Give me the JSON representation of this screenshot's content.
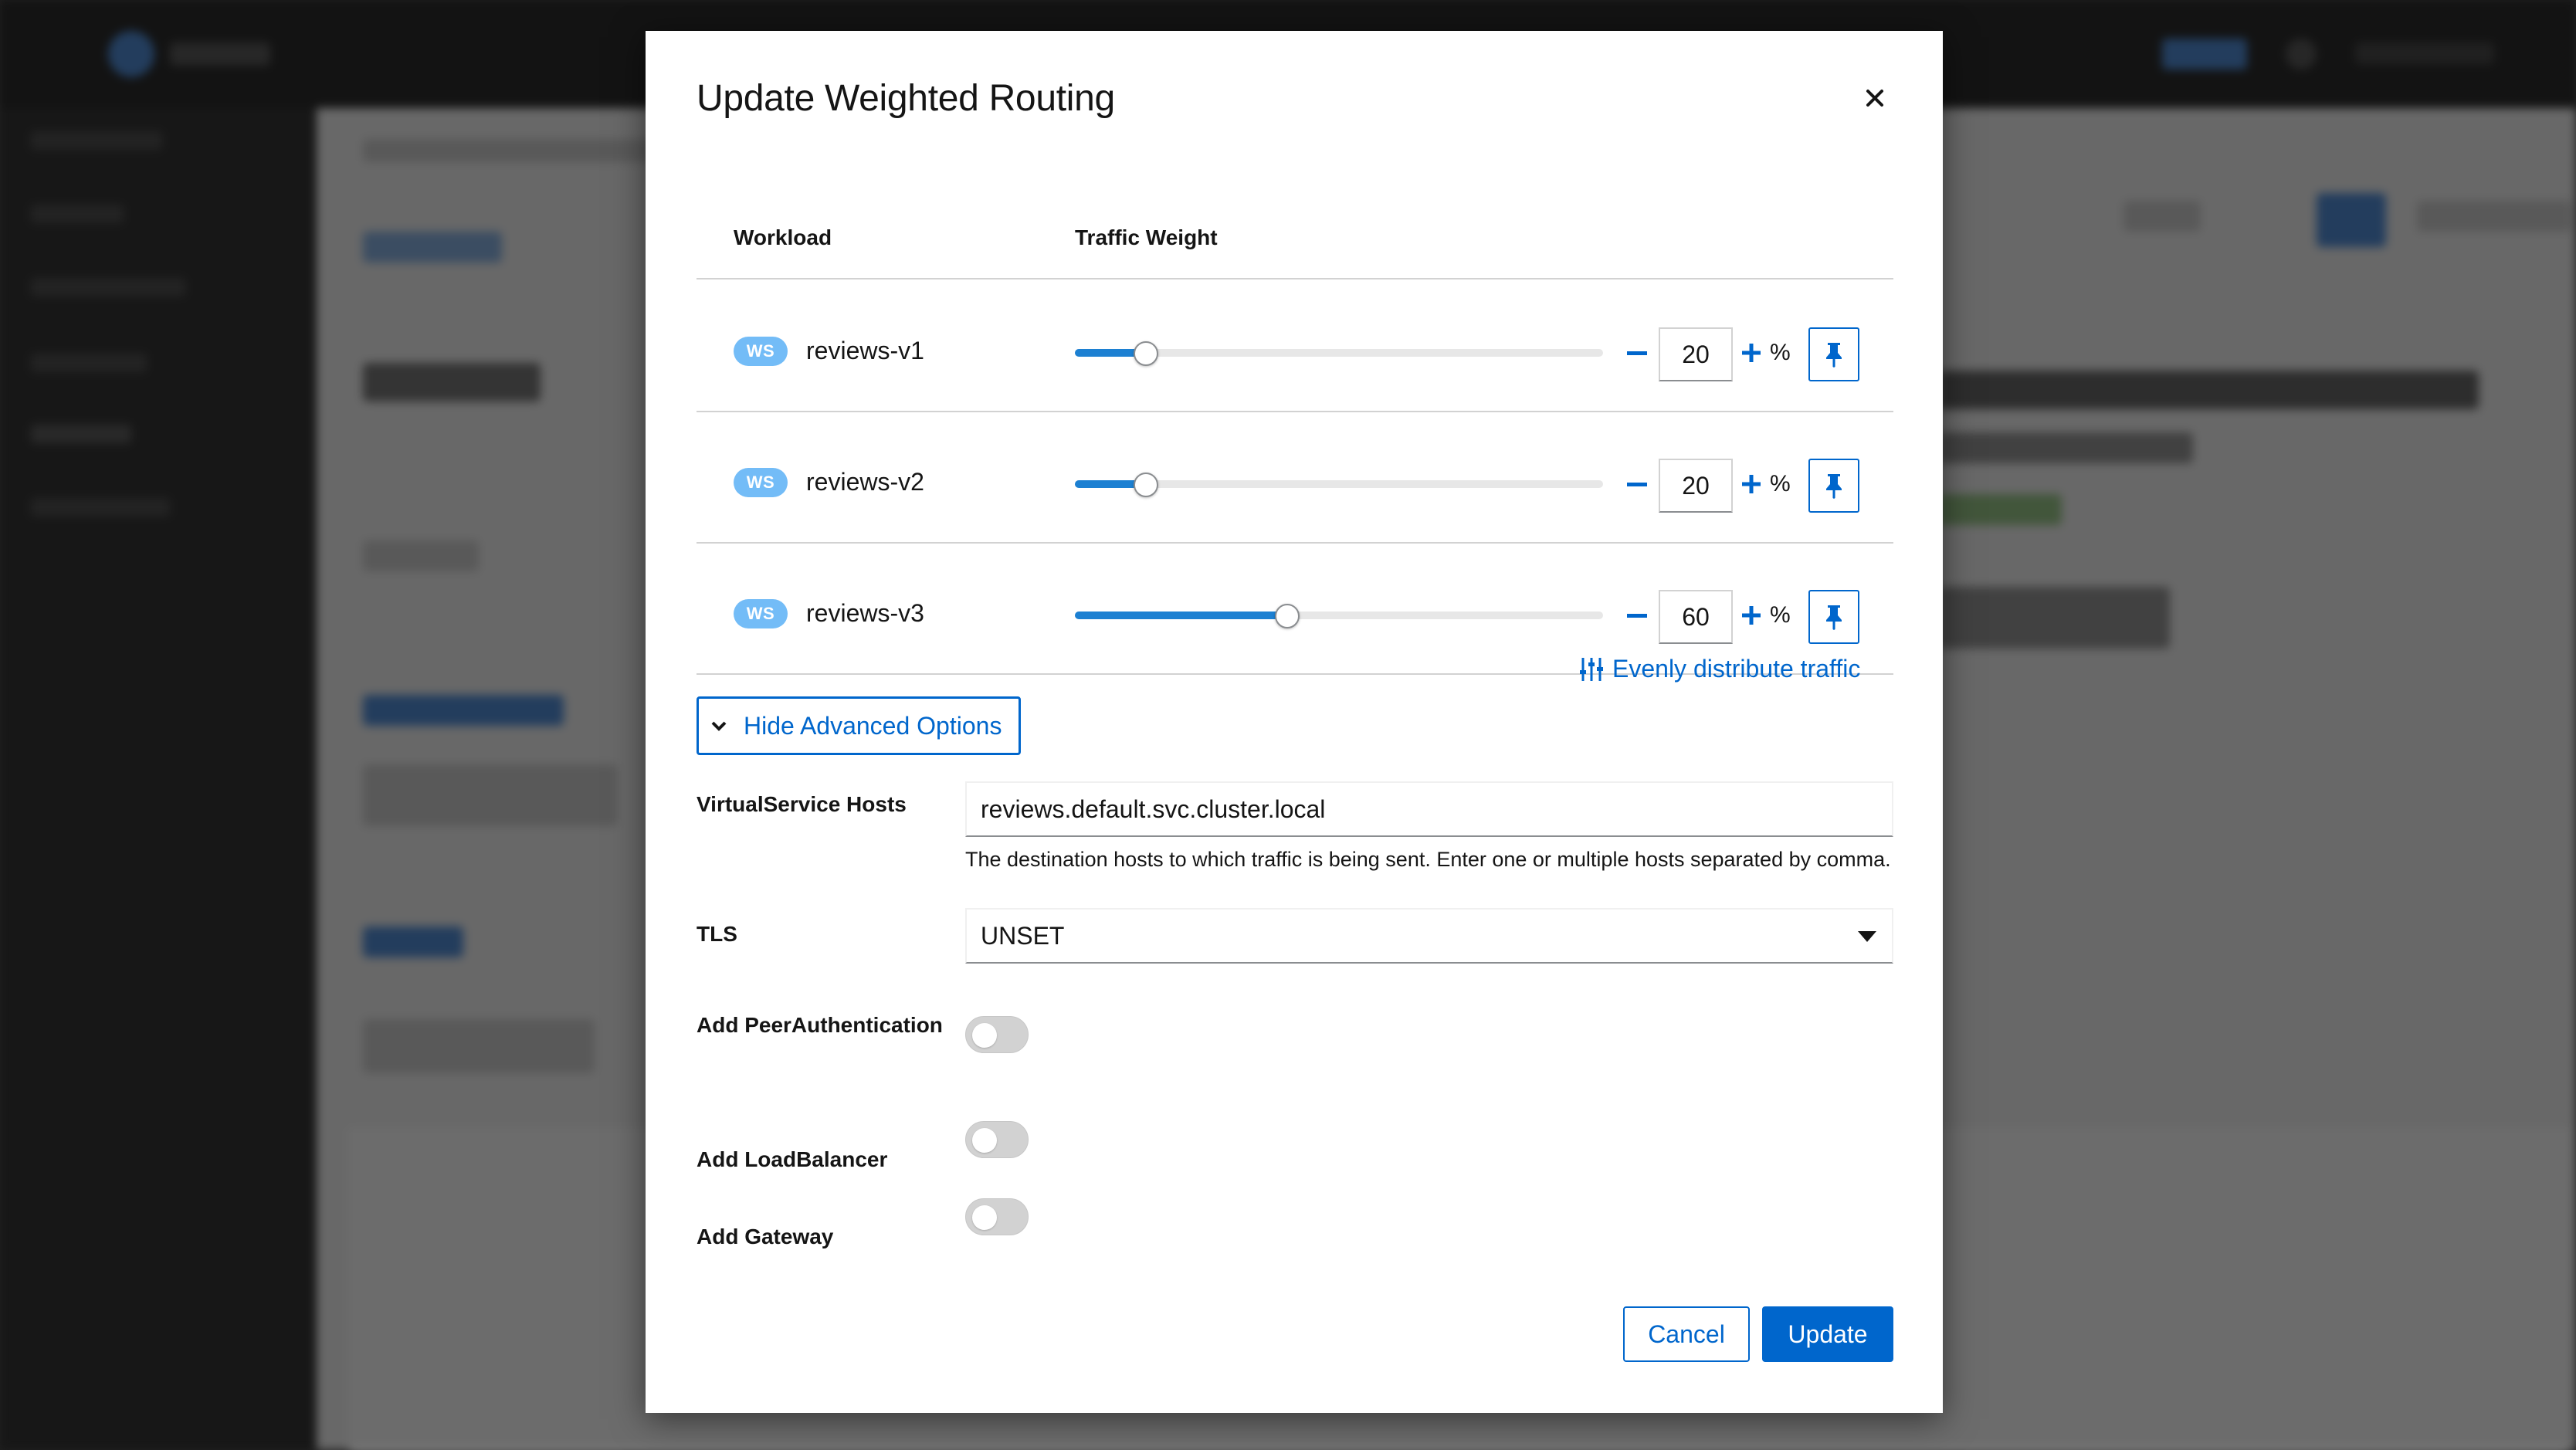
{
  "modal": {
    "title": "Update Weighted Routing",
    "columns": {
      "workload": "Workload",
      "traffic_weight": "Traffic Weight"
    },
    "rows": [
      {
        "badge": "WS",
        "name": "reviews-v1",
        "weight": "20",
        "weight_value": 20
      },
      {
        "badge": "WS",
        "name": "reviews-v2",
        "weight": "20",
        "weight_value": 20
      },
      {
        "badge": "WS",
        "name": "reviews-v3",
        "weight": "60",
        "weight_value": 60
      }
    ],
    "percent_symbol": "%",
    "evenly_distribute": "Evenly distribute traffic",
    "advanced_toggle": "Hide Advanced Options",
    "advanced": {
      "hosts_label": "VirtualService Hosts",
      "hosts_value": "reviews.default.svc.cluster.local",
      "hosts_helper": "The destination hosts to which traffic is being sent. Enter one or multiple hosts separated by comma.",
      "tls_label": "TLS",
      "tls_value": "UNSET",
      "peer_auth_label": "Add PeerAuthentication",
      "load_balancer_label": "Add LoadBalancer",
      "gateway_label": "Add Gateway",
      "peer_auth_enabled": false,
      "load_balancer_enabled": false,
      "gateway_enabled": false
    },
    "buttons": {
      "cancel": "Cancel",
      "update": "Update"
    }
  },
  "icons": [
    "close-icon",
    "minus-icon",
    "plus-icon",
    "pin-icon",
    "sliders-icon",
    "chevron-down-icon",
    "caret-down-icon"
  ],
  "colors": {
    "primary": "#0066cc",
    "slider_fill": "#1c80d2",
    "badge": "#73bcf7",
    "backdrop": "#151515"
  }
}
